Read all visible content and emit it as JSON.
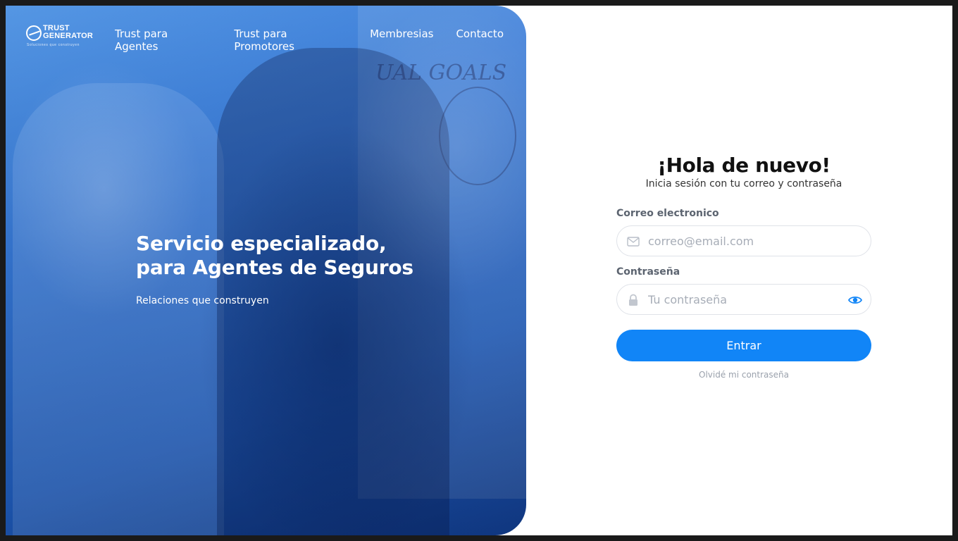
{
  "brand": {
    "logo_text_line1": "TRUST",
    "logo_text_line2": "GENERATOR",
    "logo_tagline": "Soluciones que construyen"
  },
  "nav": {
    "links": [
      {
        "label": "Trust para Agentes"
      },
      {
        "label": "Trust para Promotores"
      },
      {
        "label": "Membresias"
      },
      {
        "label": "Contacto"
      }
    ]
  },
  "hero": {
    "title_line1": "Servicio especializado,",
    "title_line2": "para Agentes de Seguros",
    "subtitle": "Relaciones que construyen",
    "image_icon": "business-handshake-photo"
  },
  "login": {
    "title": "¡Hola de nuevo!",
    "subtitle": "Inicia sesión con tu correo y contraseña",
    "email_label": "Correo electronico",
    "email_placeholder": "correo@email.com",
    "email_value": "",
    "email_icon": "mail-icon",
    "password_label": "Contraseña",
    "password_placeholder": "Tu contraseña",
    "password_value": "",
    "password_icon": "lock-icon",
    "toggle_icon": "eye-icon",
    "submit_label": "Entrar",
    "forgot_label": "Olvidé mi contraseña"
  },
  "colors": {
    "accent": "#1185f7",
    "hero_overlay": "#2f74d6",
    "label": "#5c6470"
  }
}
